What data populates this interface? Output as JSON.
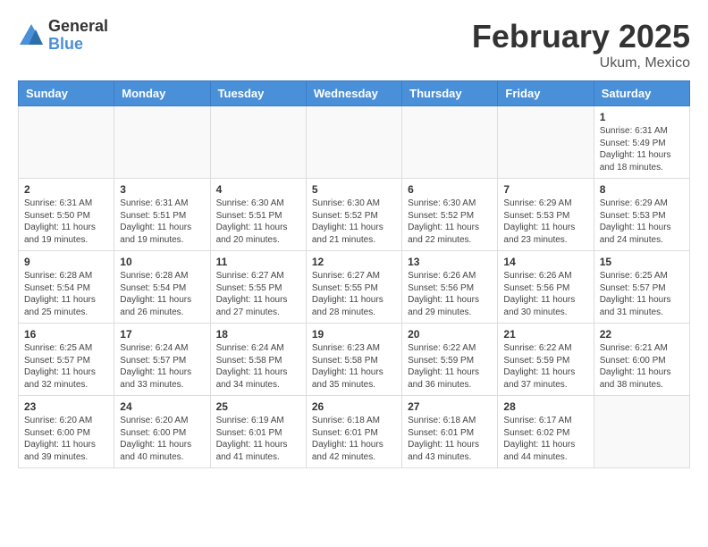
{
  "header": {
    "logo_general": "General",
    "logo_blue": "Blue",
    "month_title": "February 2025",
    "location": "Ukum, Mexico"
  },
  "days_of_week": [
    "Sunday",
    "Monday",
    "Tuesday",
    "Wednesday",
    "Thursday",
    "Friday",
    "Saturday"
  ],
  "weeks": [
    [
      {
        "day": "",
        "info": ""
      },
      {
        "day": "",
        "info": ""
      },
      {
        "day": "",
        "info": ""
      },
      {
        "day": "",
        "info": ""
      },
      {
        "day": "",
        "info": ""
      },
      {
        "day": "",
        "info": ""
      },
      {
        "day": "1",
        "info": "Sunrise: 6:31 AM\nSunset: 5:49 PM\nDaylight: 11 hours and 18 minutes."
      }
    ],
    [
      {
        "day": "2",
        "info": "Sunrise: 6:31 AM\nSunset: 5:50 PM\nDaylight: 11 hours and 19 minutes."
      },
      {
        "day": "3",
        "info": "Sunrise: 6:31 AM\nSunset: 5:51 PM\nDaylight: 11 hours and 19 minutes."
      },
      {
        "day": "4",
        "info": "Sunrise: 6:30 AM\nSunset: 5:51 PM\nDaylight: 11 hours and 20 minutes."
      },
      {
        "day": "5",
        "info": "Sunrise: 6:30 AM\nSunset: 5:52 PM\nDaylight: 11 hours and 21 minutes."
      },
      {
        "day": "6",
        "info": "Sunrise: 6:30 AM\nSunset: 5:52 PM\nDaylight: 11 hours and 22 minutes."
      },
      {
        "day": "7",
        "info": "Sunrise: 6:29 AM\nSunset: 5:53 PM\nDaylight: 11 hours and 23 minutes."
      },
      {
        "day": "8",
        "info": "Sunrise: 6:29 AM\nSunset: 5:53 PM\nDaylight: 11 hours and 24 minutes."
      }
    ],
    [
      {
        "day": "9",
        "info": "Sunrise: 6:28 AM\nSunset: 5:54 PM\nDaylight: 11 hours and 25 minutes."
      },
      {
        "day": "10",
        "info": "Sunrise: 6:28 AM\nSunset: 5:54 PM\nDaylight: 11 hours and 26 minutes."
      },
      {
        "day": "11",
        "info": "Sunrise: 6:27 AM\nSunset: 5:55 PM\nDaylight: 11 hours and 27 minutes."
      },
      {
        "day": "12",
        "info": "Sunrise: 6:27 AM\nSunset: 5:55 PM\nDaylight: 11 hours and 28 minutes."
      },
      {
        "day": "13",
        "info": "Sunrise: 6:26 AM\nSunset: 5:56 PM\nDaylight: 11 hours and 29 minutes."
      },
      {
        "day": "14",
        "info": "Sunrise: 6:26 AM\nSunset: 5:56 PM\nDaylight: 11 hours and 30 minutes."
      },
      {
        "day": "15",
        "info": "Sunrise: 6:25 AM\nSunset: 5:57 PM\nDaylight: 11 hours and 31 minutes."
      }
    ],
    [
      {
        "day": "16",
        "info": "Sunrise: 6:25 AM\nSunset: 5:57 PM\nDaylight: 11 hours and 32 minutes."
      },
      {
        "day": "17",
        "info": "Sunrise: 6:24 AM\nSunset: 5:57 PM\nDaylight: 11 hours and 33 minutes."
      },
      {
        "day": "18",
        "info": "Sunrise: 6:24 AM\nSunset: 5:58 PM\nDaylight: 11 hours and 34 minutes."
      },
      {
        "day": "19",
        "info": "Sunrise: 6:23 AM\nSunset: 5:58 PM\nDaylight: 11 hours and 35 minutes."
      },
      {
        "day": "20",
        "info": "Sunrise: 6:22 AM\nSunset: 5:59 PM\nDaylight: 11 hours and 36 minutes."
      },
      {
        "day": "21",
        "info": "Sunrise: 6:22 AM\nSunset: 5:59 PM\nDaylight: 11 hours and 37 minutes."
      },
      {
        "day": "22",
        "info": "Sunrise: 6:21 AM\nSunset: 6:00 PM\nDaylight: 11 hours and 38 minutes."
      }
    ],
    [
      {
        "day": "23",
        "info": "Sunrise: 6:20 AM\nSunset: 6:00 PM\nDaylight: 11 hours and 39 minutes."
      },
      {
        "day": "24",
        "info": "Sunrise: 6:20 AM\nSunset: 6:00 PM\nDaylight: 11 hours and 40 minutes."
      },
      {
        "day": "25",
        "info": "Sunrise: 6:19 AM\nSunset: 6:01 PM\nDaylight: 11 hours and 41 minutes."
      },
      {
        "day": "26",
        "info": "Sunrise: 6:18 AM\nSunset: 6:01 PM\nDaylight: 11 hours and 42 minutes."
      },
      {
        "day": "27",
        "info": "Sunrise: 6:18 AM\nSunset: 6:01 PM\nDaylight: 11 hours and 43 minutes."
      },
      {
        "day": "28",
        "info": "Sunrise: 6:17 AM\nSunset: 6:02 PM\nDaylight: 11 hours and 44 minutes."
      },
      {
        "day": "",
        "info": ""
      }
    ]
  ]
}
